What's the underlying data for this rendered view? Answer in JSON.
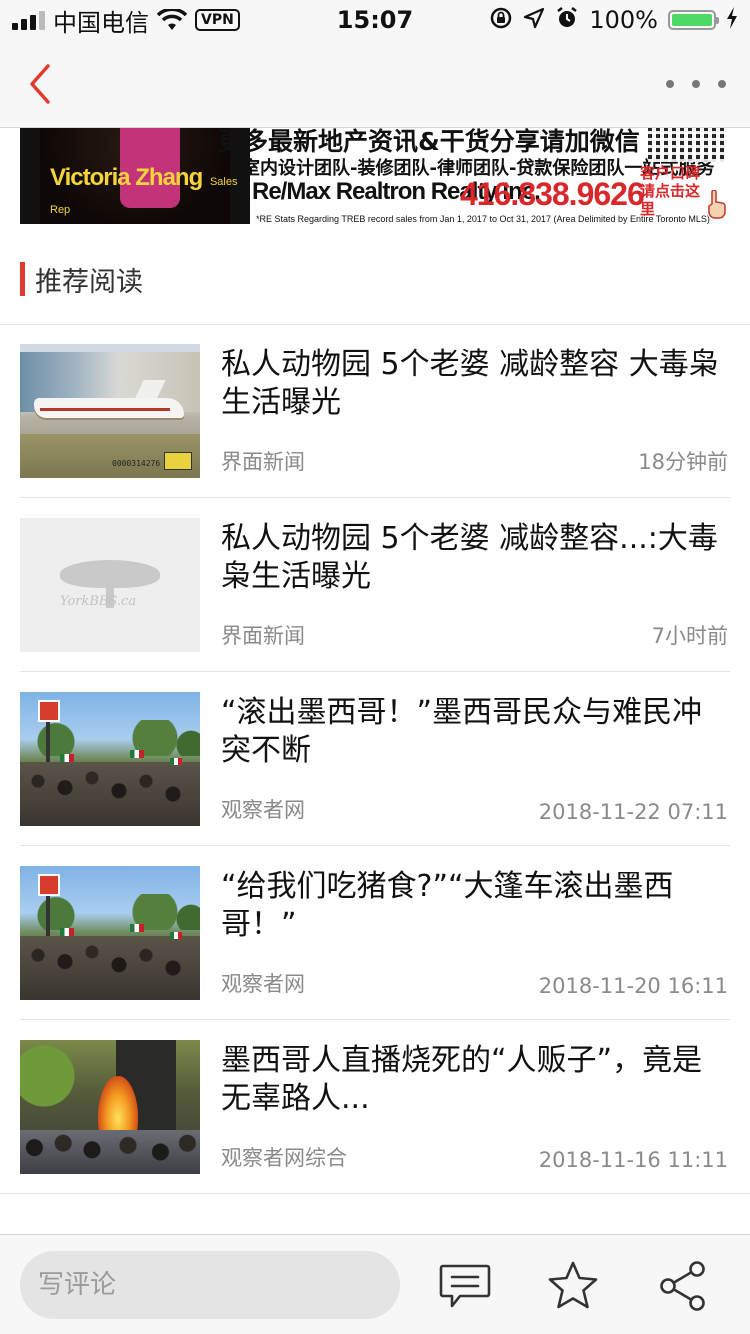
{
  "status_bar": {
    "carrier": "中国电信",
    "vpn": "VPN",
    "time": "15:07",
    "battery": "100%"
  },
  "banner": {
    "headline": "更多最新地产资讯&干货分享请加微信",
    "services": "室内设计团队-装修团队-律师团队-贷款保险团队一站式服务",
    "agent_name": "Victoria Zhang",
    "agent_title": "Sales Rep",
    "company": "Re/Max Realtron Realty Inc.",
    "phone": "416.838.9626",
    "cta": "客户口碑请点击这里",
    "footnote": "*RE Stats Regarding TREB record sales from Jan 1, 2017 to Oct 31, 2017 (Area Delimited by Entire Toronto MLS)"
  },
  "section": {
    "title": "推荐阅读"
  },
  "articles": [
    {
      "title": "私人动物园 5个老婆 减龄整容 大毒枭生活曝光",
      "source": "界面新闻",
      "time": "18分钟前",
      "thumb": "jet-photo",
      "thumb_code": "0000314276"
    },
    {
      "title": "私人动物园 5个老婆 减龄整容...:大毒枭生活曝光",
      "source": "界面新闻",
      "time": "7小时前",
      "thumb": "placeholder-logo",
      "thumb_brand": "YorkBBS.ca"
    },
    {
      "title": "“滚出墨西哥！”墨西哥民众与难民冲突不断",
      "source": "观察者网",
      "time": "2018-11-22 07:11",
      "thumb": "crowd-photo"
    },
    {
      "title": "“给我们吃猪食?”“大篷车滚出墨西哥！”",
      "source": "观察者网",
      "time": "2018-11-20 16:11",
      "thumb": "crowd-photo"
    },
    {
      "title": "墨西哥人直播烧死的“人贩子”，竟是无辜路人...",
      "source": "观察者网综合",
      "time": "2018-11-16 11:11",
      "thumb": "fire-photo"
    }
  ],
  "bottom_bar": {
    "comment_placeholder": "写评论"
  },
  "colors": {
    "accent": "#e03a2f",
    "nav_bg": "#f7f7f7",
    "meta_text": "#8a8a8a",
    "battery": "#4cd964",
    "phone": "#d8282b"
  },
  "icons": {
    "back": "chevron-left-icon",
    "more": "more-dots-icon",
    "comment": "comment-bubble-icon",
    "favorite": "star-icon",
    "share": "share-icon"
  }
}
